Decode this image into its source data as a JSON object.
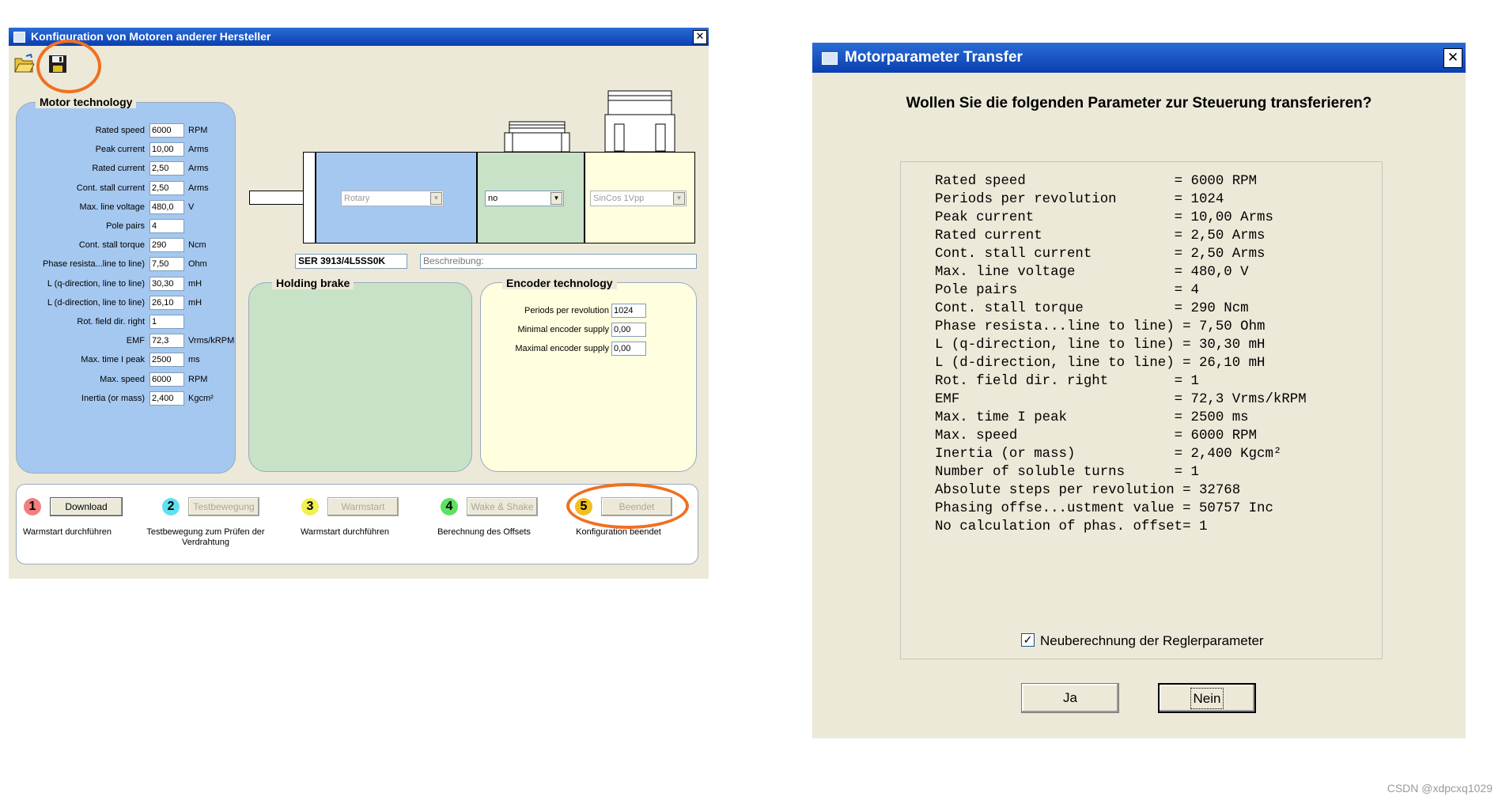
{
  "config_window": {
    "title": "Konfiguration von Motoren anderer Hersteller",
    "close": "✕",
    "toolbar": {
      "open_icon": "folder-open-icon",
      "save_icon": "floppy-disk-icon"
    },
    "motor_technology": {
      "title": "Motor technology",
      "params": [
        {
          "label": "Rated speed",
          "value": "6000",
          "unit": "RPM"
        },
        {
          "label": "Peak current",
          "value": "10,00",
          "unit": "Arms"
        },
        {
          "label": "Rated current",
          "value": "2,50",
          "unit": "Arms"
        },
        {
          "label": "Cont. stall current",
          "value": "2,50",
          "unit": "Arms"
        },
        {
          "label": "Max. line voltage",
          "value": "480,0",
          "unit": "V"
        },
        {
          "label": "Pole pairs",
          "value": "4",
          "unit": ""
        },
        {
          "label": "Cont. stall torque",
          "value": "290",
          "unit": "Ncm"
        },
        {
          "label": "Phase resista...line to line)",
          "value": "7,50",
          "unit": "Ohm"
        },
        {
          "label": "L (q-direction, line to line)",
          "value": "30,30",
          "unit": "mH"
        },
        {
          "label": "L (d-direction, line to line)",
          "value": "26,10",
          "unit": "mH"
        },
        {
          "label": "Rot. field dir. right",
          "value": "1",
          "unit": ""
        },
        {
          "label": "EMF",
          "value": "72,3",
          "unit": "Vrms/kRPM"
        },
        {
          "label": "Max. time I peak",
          "value": "2500",
          "unit": "ms"
        },
        {
          "label": "Max. speed",
          "value": "6000",
          "unit": "RPM"
        },
        {
          "label": "Inertia (or mass)",
          "value": "2,400",
          "unit": "Kgcm²"
        }
      ]
    },
    "motor_type_select": "Rotary",
    "brake_select": "no",
    "encoder_select": "SinCos 1Vpp",
    "motor_name": "SER 3913/4L5SS0K",
    "description": "Beschreibung:",
    "holding_brake": {
      "title": "Holding brake"
    },
    "encoder_technology": {
      "title": "Encoder technology",
      "params": [
        {
          "label": "Periods per revolution",
          "value": "1024"
        },
        {
          "label": "Minimal encoder supply",
          "value": "0,00"
        },
        {
          "label": "Maximal encoder supply",
          "value": "0,00"
        }
      ]
    },
    "steps": [
      {
        "num": "1",
        "color": "#f08080",
        "button": "Download",
        "enabled": true,
        "caption": "Warmstart durchführen"
      },
      {
        "num": "2",
        "color": "#5fdff0",
        "button": "Testbewegung",
        "enabled": false,
        "caption": "Testbewegung zum Prüfen der Verdrahtung"
      },
      {
        "num": "3",
        "color": "#f0f050",
        "button": "Warmstart",
        "enabled": false,
        "caption": "Warmstart durchführen"
      },
      {
        "num": "4",
        "color": "#60e060",
        "button": "Wake & Shake",
        "enabled": false,
        "caption": "Berechnung des Offsets"
      },
      {
        "num": "5",
        "color": "#f0c020",
        "button": "Beendet",
        "enabled": false,
        "caption": "Konfiguration beendet"
      }
    ]
  },
  "transfer_dialog": {
    "title": "Motorparameter Transfer",
    "close": "✕",
    "question": "Wollen Sie die folgenden Parameter zur Steuerung transferieren?",
    "lines": [
      "Rated speed                  = 6000 RPM",
      "Periods per revolution       = 1024",
      "Peak current                 = 10,00 Arms",
      "Rated current                = 2,50 Arms",
      "Cont. stall current          = 2,50 Arms",
      "Max. line voltage            = 480,0 V",
      "Pole pairs                   = 4",
      "Cont. stall torque           = 290 Ncm",
      "Phase resista...line to line) = 7,50 Ohm",
      "L (q-direction, line to line) = 30,30 mH",
      "L (d-direction, line to line) = 26,10 mH",
      "Rot. field dir. right        = 1",
      "EMF                          = 72,3 Vrms/kRPM",
      "Max. time I peak             = 2500 ms",
      "Max. speed                   = 6000 RPM",
      "Inertia (or mass)            = 2,400 Kgcm²",
      "Number of soluble turns      = 1",
      "Absolute steps per revolution = 32768",
      "Phasing offse...ustment value = 50757 Inc",
      "No calculation of phas. offset= 1"
    ],
    "checkbox_label": "Neuberechnung der Reglerparameter",
    "checkbox_checked": true,
    "checkbox_mark": "✓",
    "yes_button": "Ja",
    "no_button": "Nein"
  },
  "watermark": "CSDN @xdpcxq1029"
}
